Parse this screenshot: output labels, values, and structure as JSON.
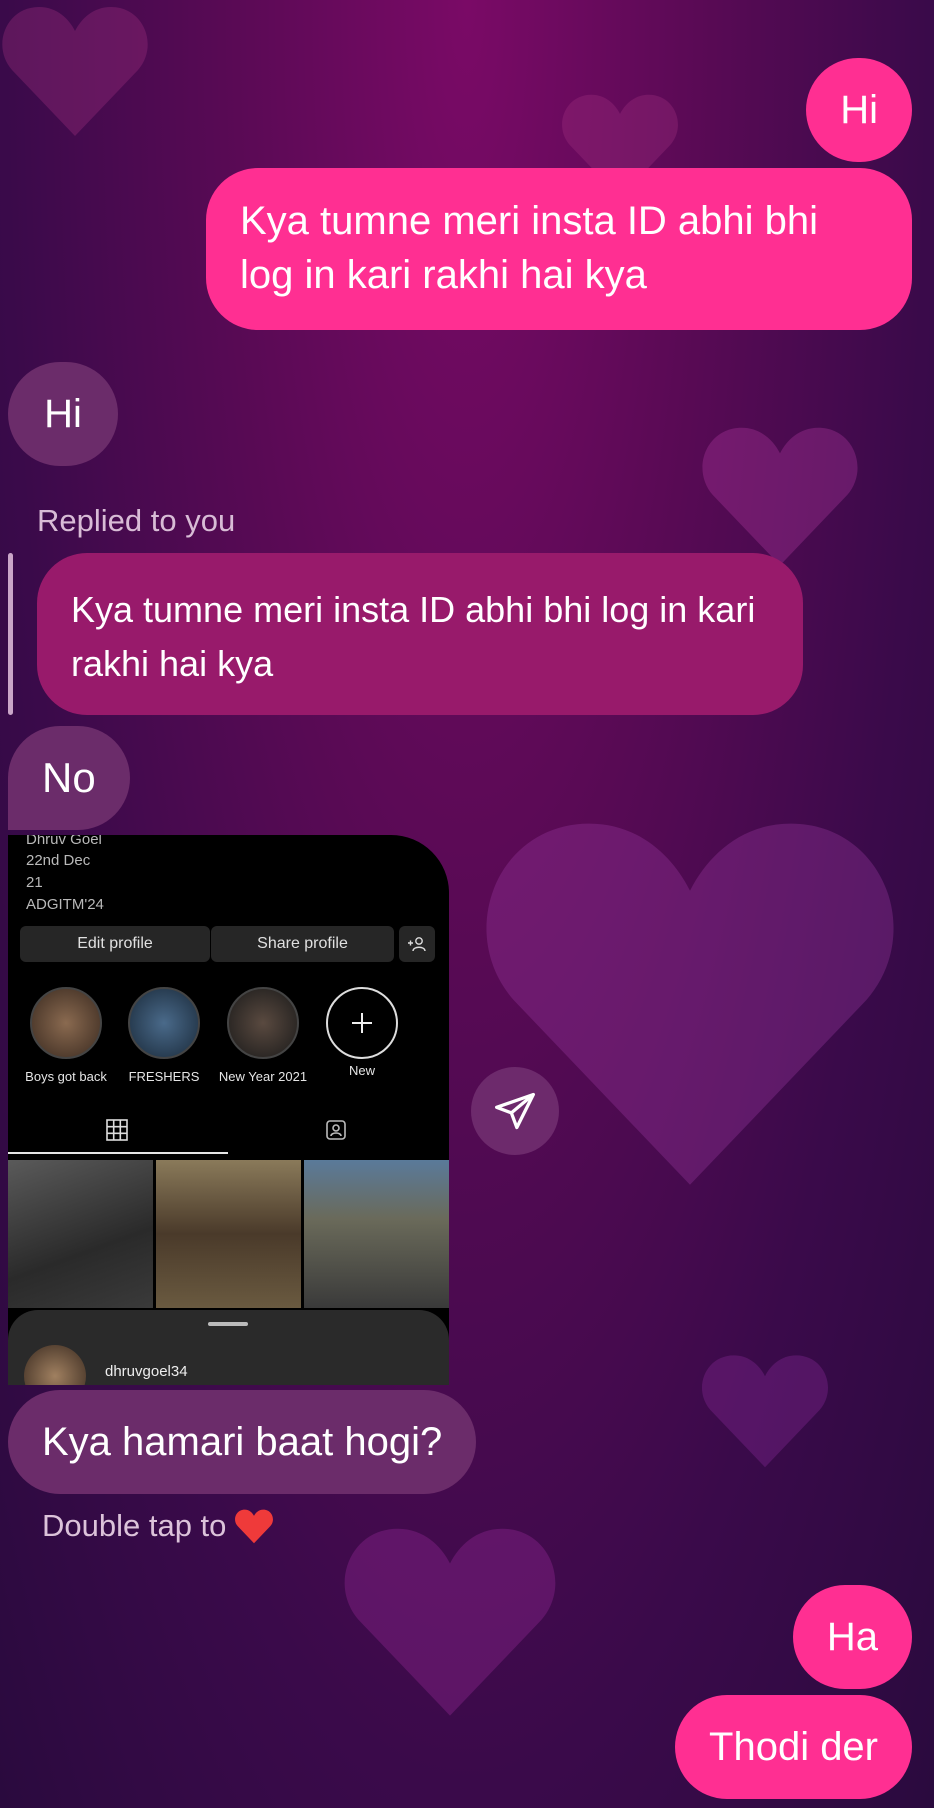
{
  "messages": {
    "out_1": "Hi",
    "out_2": "Kya tumne meri insta ID abhi bhi log in kari rakhi hai kya",
    "in_1": "Hi",
    "replied_label": "Replied to you",
    "reply_quote": "Kya tumne meri insta ID abhi bhi log in kari rakhi hai kya",
    "in_2": "No",
    "in_3": "Kya hamari baat hogi?",
    "double_tap_hint": "Double tap to",
    "out_3": "Ha",
    "out_4": "Thodi der"
  },
  "shared_profile": {
    "bio_lines": [
      "Dhruv Goel",
      "22nd Dec",
      "21",
      "ADGITM'24"
    ],
    "edit_profile": "Edit profile",
    "share_profile": "Share profile",
    "highlights": [
      "Boys got back",
      "FRESHERS",
      "New Year 2021",
      "New"
    ],
    "username": "dhruvgoel34"
  },
  "icons": {
    "send": "send-icon",
    "heart": "red-heart-emoji",
    "grid": "grid-icon",
    "tagged": "tagged-icon",
    "add_person": "add-person-icon",
    "plus": "plus-icon"
  },
  "colors": {
    "outgoing_bubble": "#ff2f92",
    "incoming_bubble": "#6b2c6a",
    "reply_bubble": "#981a6b"
  }
}
